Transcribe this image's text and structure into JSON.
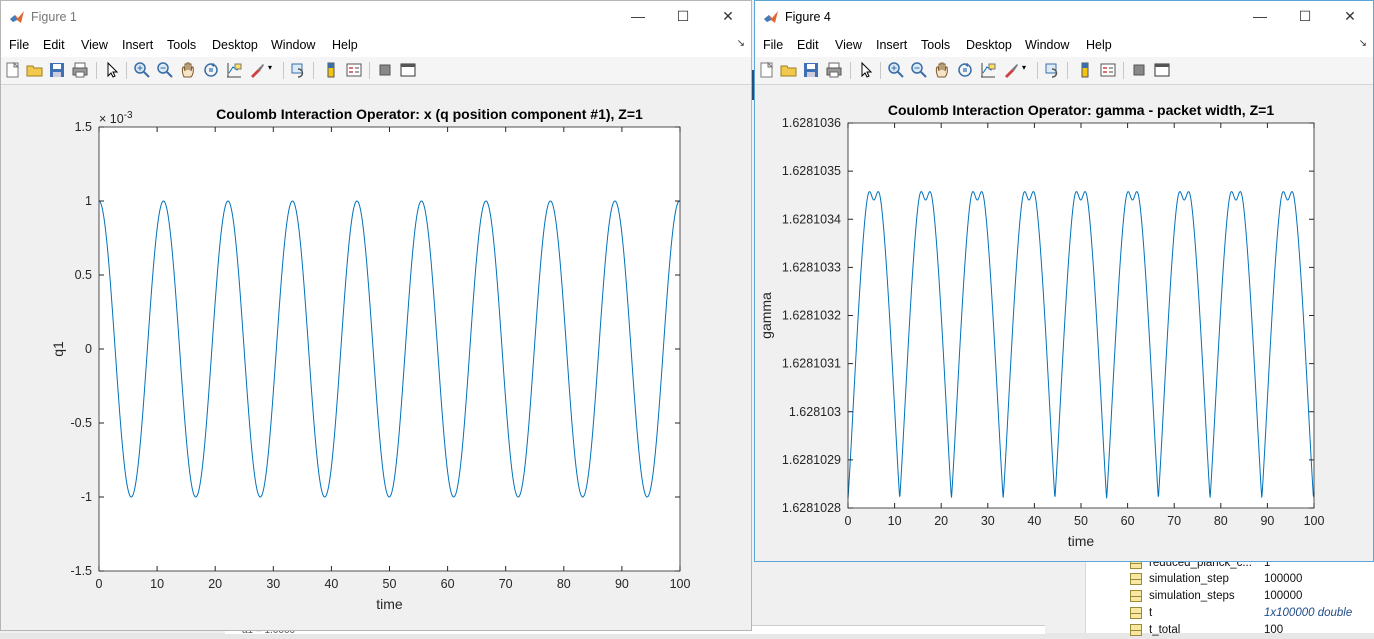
{
  "workspace": {
    "rows": [
      {
        "name": "reduced_planck_c...",
        "value": "1",
        "italic": false
      },
      {
        "name": "simulation_step",
        "value": "100000",
        "italic": false
      },
      {
        "name": "simulation_steps",
        "value": "100000",
        "italic": false
      },
      {
        "name": "t",
        "value": "1x100000 double",
        "italic": true
      },
      {
        "name": "t_total",
        "value": "100",
        "italic": false
      }
    ]
  },
  "command_snippet": "a1 =    1.0000",
  "menus": [
    "File",
    "Edit",
    "View",
    "Insert",
    "Tools",
    "Desktop",
    "Window",
    "Help"
  ],
  "figure1": {
    "title": "Figure 1",
    "chart_data": {
      "type": "line",
      "title": "Coulomb Interaction Operator: x (q position component #1), Z=1",
      "xlabel": "time",
      "ylabel": "q1",
      "exponent_label": "× 10",
      "exponent_power": "-3",
      "xlim": [
        0,
        100
      ],
      "ylim": [
        -1.5,
        1.5
      ],
      "y_scale_factor": 0.001,
      "xticks": [
        "0",
        "10",
        "20",
        "30",
        "40",
        "50",
        "60",
        "70",
        "80",
        "90",
        "100"
      ],
      "yticks": [
        "-1.5",
        "-1",
        "-0.5",
        "0",
        "0.5",
        "1",
        "1.5"
      ],
      "series": [
        {
          "function": "cos",
          "amplitude": 1.0,
          "period": 11.1,
          "offset": 0,
          "color": "#0072bd"
        }
      ],
      "x_range": [
        0,
        100
      ]
    }
  },
  "figure4": {
    "title": "Figure 4",
    "chart_data": {
      "type": "line",
      "title": "Coulomb Interaction Operator: gamma - packet width, Z=1",
      "xlabel": "time",
      "ylabel": "gamma",
      "xlim": [
        0,
        100
      ],
      "ylim": [
        1.6281028,
        1.6281036
      ],
      "xticks": [
        "0",
        "10",
        "20",
        "30",
        "40",
        "50",
        "60",
        "70",
        "80",
        "90",
        "100"
      ],
      "yticks": [
        "1.6281028",
        "1.6281029",
        "1.628103",
        "1.6281031",
        "1.6281032",
        "1.6281033",
        "1.6281034",
        "1.6281035",
        "1.6281036"
      ],
      "series": [
        {
          "function": "double-peak",
          "min": 1.62810282,
          "max": 1.62810351,
          "dip": 1.62810344,
          "period": 11.1,
          "color": "#0072bd"
        }
      ],
      "x_range": [
        0,
        100
      ]
    }
  },
  "colors": {
    "line": "#0072bd",
    "titlebar_active_border": "#5ba6d8"
  }
}
